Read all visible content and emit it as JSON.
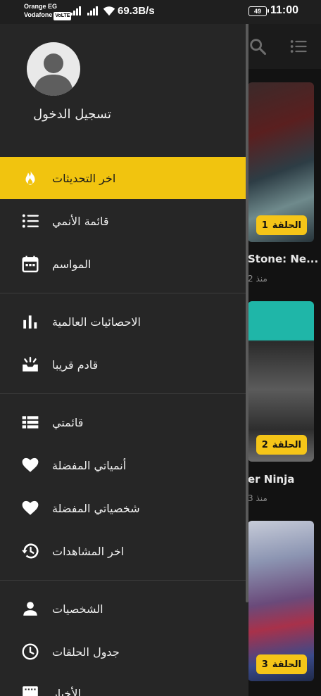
{
  "status_bar": {
    "carrier_1": "Orange EG",
    "carrier_2": "Vodafone",
    "volte": "VoLTE",
    "net_speed": "69.3B/s",
    "battery": "49",
    "time": "11:00"
  },
  "drawer": {
    "login_label": "تسجيل الدخول",
    "menu": [
      {
        "label": "اخر التحديثات",
        "icon": "fire-icon",
        "active": true
      },
      {
        "label": "قائمة الأنمي",
        "icon": "list-icon"
      },
      {
        "label": "المواسم",
        "icon": "calendar-icon"
      },
      {
        "label": "الاحصائيات العالمية",
        "icon": "bar-chart-icon"
      },
      {
        "label": "قادم قريبا",
        "icon": "new-release-icon"
      },
      {
        "label": "قائمتي",
        "icon": "view-list-icon"
      },
      {
        "label": "أنمياتي المفضلة",
        "icon": "heart-icon"
      },
      {
        "label": "شخصياتي المفضلة",
        "icon": "heart-icon"
      },
      {
        "label": "اخر المشاهدات",
        "icon": "history-icon"
      },
      {
        "label": "الشخصيات",
        "icon": "person-icon"
      },
      {
        "label": "جدول الحلقات",
        "icon": "clock-icon"
      },
      {
        "label": "الأخبار",
        "icon": "news-icon"
      }
    ],
    "accent_color": "#f1c40f"
  },
  "background": {
    "cards": [
      {
        "badge_label": "الحلقة",
        "badge_number": "1",
        "title": "Stone: Ne...",
        "subtitle": "منذ 2"
      },
      {
        "badge_label": "الحلقة",
        "badge_number": "2",
        "title": "er Ninja",
        "subtitle": "منذ 3"
      },
      {
        "badge_label": "الحلقة",
        "badge_number": "3"
      }
    ]
  }
}
